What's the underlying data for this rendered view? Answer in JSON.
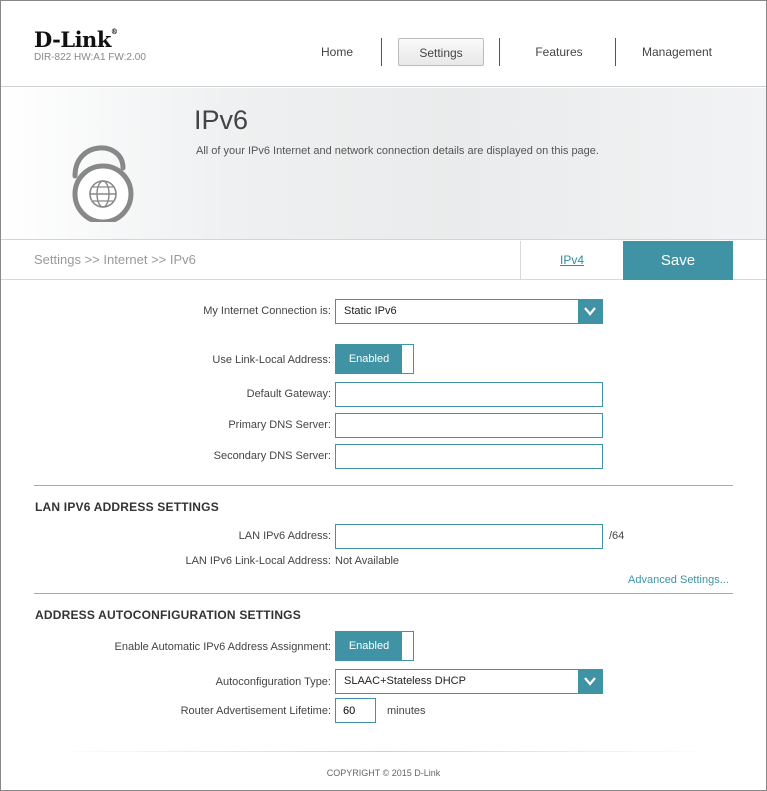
{
  "brand": {
    "logo": "D-Link",
    "model": "DIR-822 HW:A1 FW:2.00"
  },
  "nav": {
    "items": [
      {
        "label": "Home"
      },
      {
        "label": "Settings"
      },
      {
        "label": "Features"
      },
      {
        "label": "Management"
      }
    ],
    "active": "Settings"
  },
  "hero": {
    "title": "IPv6",
    "description": "All of your IPv6 Internet and network connection details are displayed on this page.",
    "icon": "globe-lock-icon"
  },
  "breadcrumb": {
    "path": "Settings >> Internet >> IPv6",
    "ipv4_link": "IPv4",
    "save_label": "Save"
  },
  "connection": {
    "type_label": "My Internet Connection is:",
    "type_value": "Static IPv6",
    "link_local_label": "Use Link-Local Address:",
    "link_local_value": "Enabled",
    "gateway_label": "Default Gateway:",
    "gateway_value": "",
    "primary_dns_label": "Primary DNS Server:",
    "primary_dns_value": "",
    "secondary_dns_label": "Secondary DNS Server:",
    "secondary_dns_value": ""
  },
  "lan": {
    "section_title": "LAN IPV6 ADDRESS SETTINGS",
    "address_label": "LAN IPv6 Address:",
    "address_value": "",
    "prefix_suffix": "/64",
    "link_local_label": "LAN IPv6 Link-Local Address:",
    "link_local_value": "Not Available",
    "advanced_link": "Advanced Settings..."
  },
  "autoconfig": {
    "section_title": "ADDRESS AUTOCONFIGURATION SETTINGS",
    "enable_label": "Enable Automatic IPv6 Address Assignment:",
    "enable_value": "Enabled",
    "type_label": "Autoconfiguration Type:",
    "type_value": "SLAAC+Stateless DHCP",
    "lifetime_label": "Router Advertisement Lifetime:",
    "lifetime_value": "60",
    "lifetime_unit": "minutes"
  },
  "footer": {
    "copyright": "COPYRIGHT © 2015 D-Link"
  },
  "colors": {
    "accent": "#3f93a4",
    "link": "#2f8aa0"
  }
}
